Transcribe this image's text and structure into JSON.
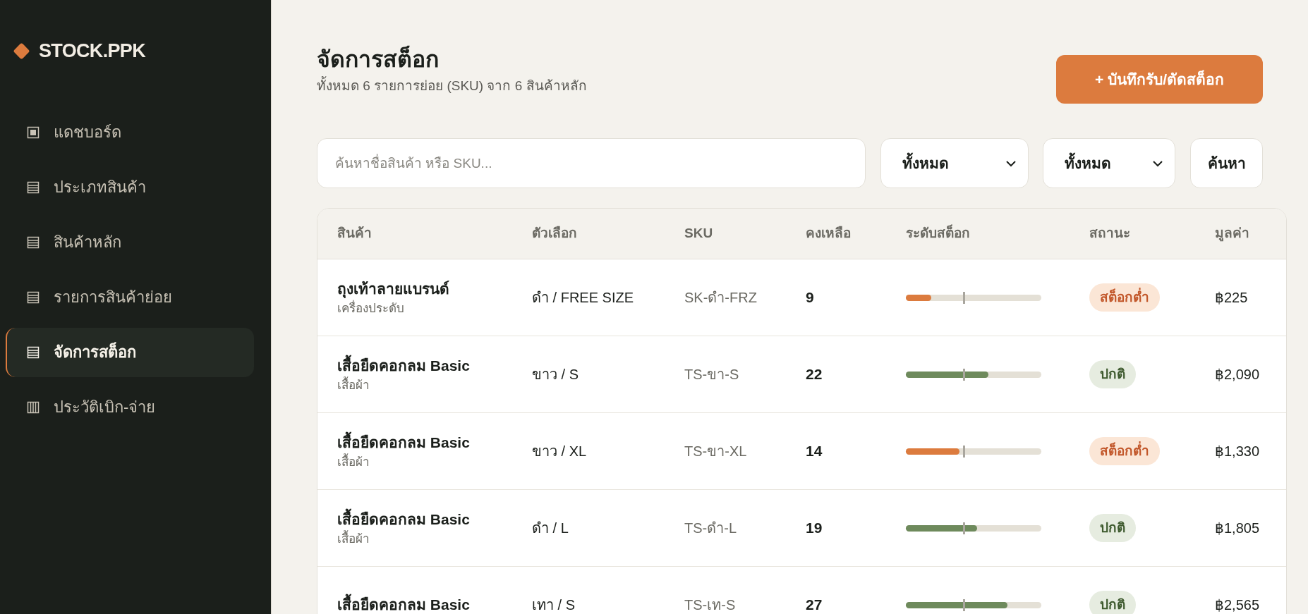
{
  "brand": {
    "name": "STOCK.PPK"
  },
  "sidebar": {
    "items": [
      {
        "label": "แดชบอร์ด",
        "kind": "dashboard",
        "selected": false
      },
      {
        "label": "ประเภทสินค้า",
        "kind": "list",
        "selected": false
      },
      {
        "label": "สินค้าหลัก",
        "kind": "list",
        "selected": false
      },
      {
        "label": "รายการสินค้าย่อย",
        "kind": "list",
        "selected": false
      },
      {
        "label": "จัดการสต็อก",
        "kind": "list",
        "selected": true
      },
      {
        "label": "ประวัติเบิก-จ่าย",
        "kind": "history",
        "selected": false
      }
    ]
  },
  "header": {
    "title": "จัดการสต็อก",
    "subtitle": "ทั้งหมด 6 รายการย่อย (SKU) จาก 6 สินค้าหลัก",
    "action_button": "+ บันทึกรับ/ตัดสต็อก"
  },
  "filters": {
    "search": {
      "placeholder": "ค้นหาชื่อสินค้า หรือ SKU..."
    },
    "selects": [
      {
        "value": "ทั้งหมด"
      },
      {
        "value": "ทั้งหมด"
      }
    ],
    "search_button": "ค้นหา"
  },
  "table": {
    "columns": [
      "สินค้า",
      "ตัวเลือก",
      "SKU",
      "คงเหลือ",
      "ระดับสต็อก",
      "สถานะ",
      "มูลค่า"
    ],
    "rows": [
      {
        "product": "ถุงเท้าลายแบรนด์",
        "category": "เครื่องประดับ",
        "option": "ดำ / FREE SIZE",
        "sku": "SK-ดำ-FRZ",
        "remaining": "9",
        "level": 0.185,
        "status": {
          "kind": "low",
          "label": "สต็อกต่ำ"
        },
        "value": "฿225"
      },
      {
        "product": "เสื้อยืดคอกลม Basic",
        "category": "เสื้อผ้า",
        "option": "ขาว / S",
        "sku": "TS-ขา-S",
        "remaining": "22",
        "level": 0.61,
        "status": {
          "kind": "normal",
          "label": "ปกติ"
        },
        "value": "฿2,090"
      },
      {
        "product": "เสื้อยืดคอกลม Basic",
        "category": "เสื้อผ้า",
        "option": "ขาว / XL",
        "sku": "TS-ขา-XL",
        "remaining": "14",
        "level": 0.395,
        "status": {
          "kind": "low",
          "label": "สต็อกต่ำ"
        },
        "value": "฿1,330"
      },
      {
        "product": "เสื้อยืดคอกลม Basic",
        "category": "เสื้อผ้า",
        "option": "ดำ / L",
        "sku": "TS-ดำ-L",
        "remaining": "19",
        "level": 0.525,
        "status": {
          "kind": "normal",
          "label": "ปกติ"
        },
        "value": "฿1,805"
      },
      {
        "product": "เสื้อยืดคอกลม Basic",
        "option": "เทา / S",
        "sku": "TS-เท-S",
        "remaining": "27",
        "level": 0.75,
        "status": {
          "kind": "normal",
          "label": "ปกติ"
        },
        "value": "฿2,565"
      }
    ]
  }
}
